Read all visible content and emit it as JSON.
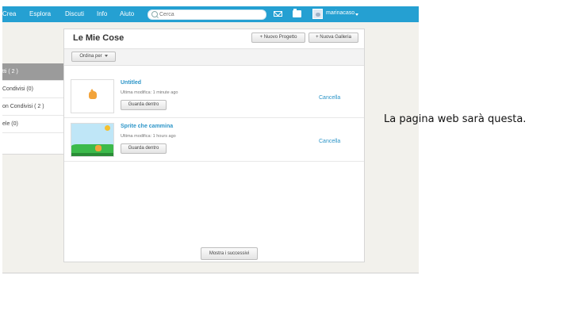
{
  "topnav": {
    "items": [
      "Crea",
      "Esplora",
      "Discuti",
      "Info",
      "Aiuto"
    ],
    "search_placeholder": "Cerca",
    "username": "marinacaso"
  },
  "sidebar": {
    "items": [
      {
        "label": "tti ( 2 )",
        "active": true
      },
      {
        "label": "Condivisi (0)",
        "active": false
      },
      {
        "label": "on Condivisi ( 2 )",
        "active": false
      },
      {
        "label": "ele (0)",
        "active": false
      }
    ]
  },
  "main": {
    "title": "Le Mie Cose",
    "new_project_label": "+ Nuovo Progetto",
    "new_gallery_label": "+ Nuova Galleria",
    "sort_label": "Ordina per",
    "show_more_label": "Mostra i successivi"
  },
  "projects": [
    {
      "title": "Untitled",
      "meta": "Ultima modifica: 1 minute ago",
      "button": "Guarda dentro",
      "cancel": "Cancella"
    },
    {
      "title": "Sprite che cammina",
      "meta": "Ultima modifica: 1 hours ago",
      "button": "Guarda dentro",
      "cancel": "Cancella"
    }
  ],
  "annotation": "La pagina web sarà questa.",
  "colors": {
    "topbar": "#25a0d2",
    "link": "#2c95c8",
    "sidebar_active": "#9b9b9b"
  }
}
